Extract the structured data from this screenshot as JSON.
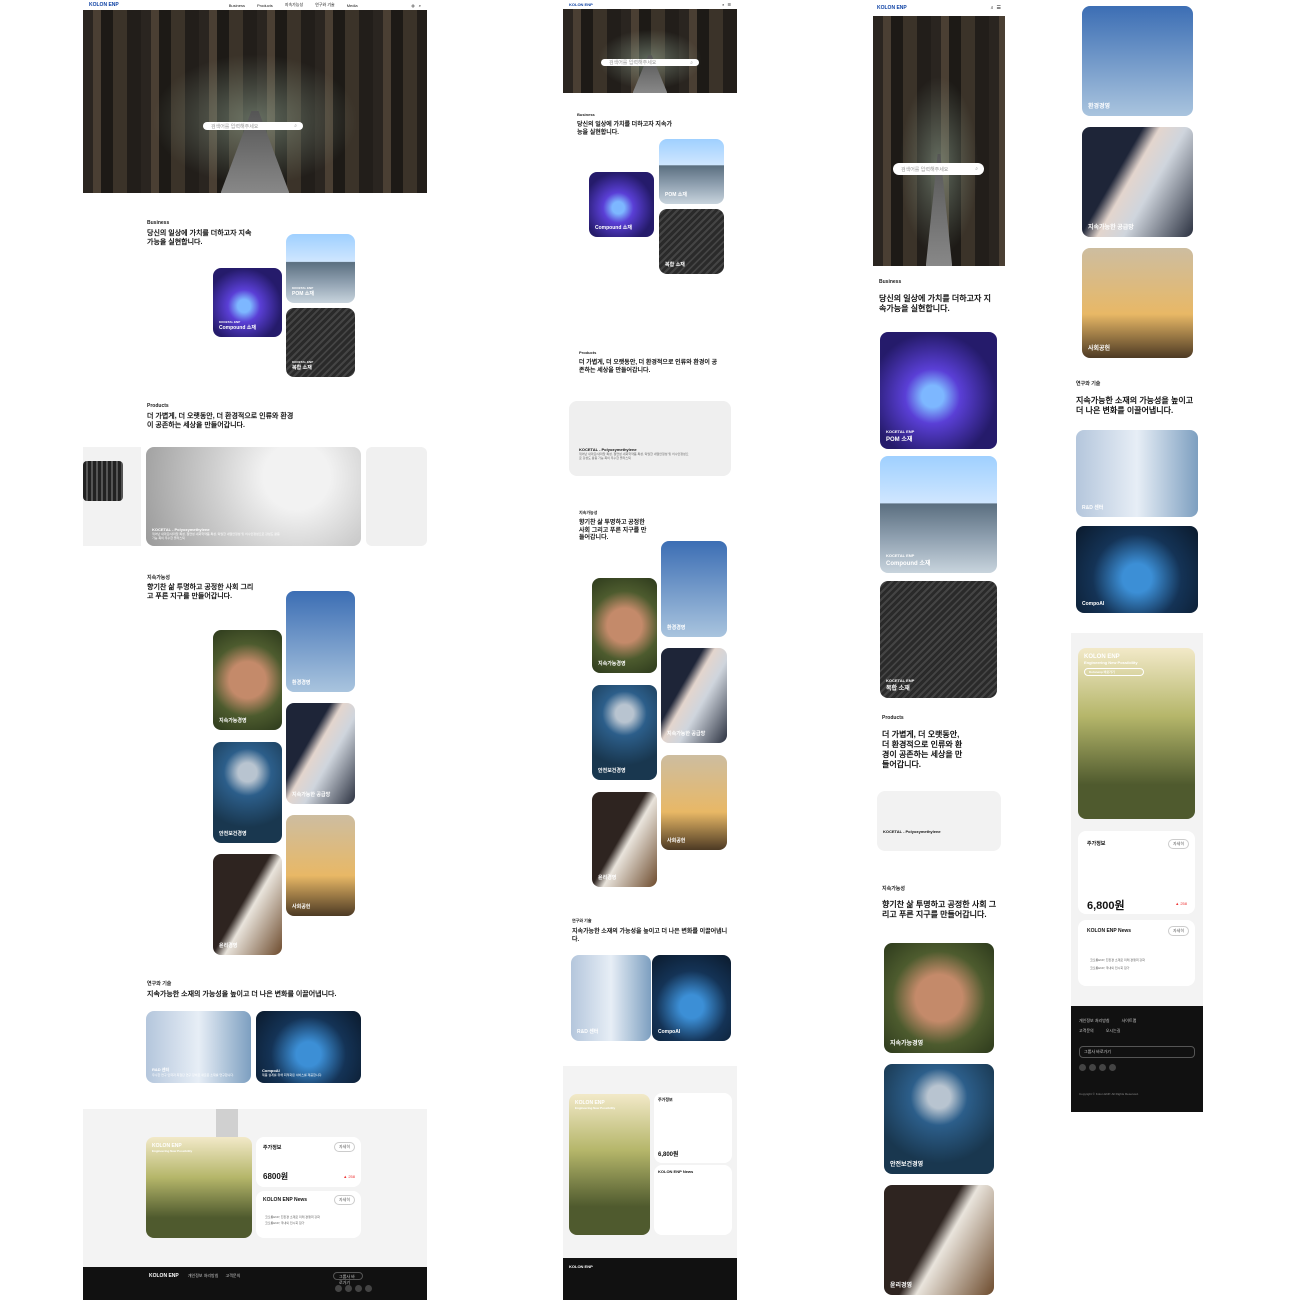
{
  "header": {
    "logo": "KOLON ENP",
    "nav": [
      "Business",
      "Products",
      "지속가능성",
      "연구와 기술",
      "Media"
    ]
  },
  "hero": {
    "search_placeholder": "검색어를 입력해주세요"
  },
  "business": {
    "label": "Business",
    "title": "당신의 일상에 가치를 더하고자 지속가능을 실현합니다.",
    "items": [
      {
        "tag": "KOCETAL ENP",
        "name": "Compound 소재"
      },
      {
        "tag": "KOCETAL ENP",
        "name": "POM 소재"
      },
      {
        "tag": "KOCETAL ENP",
        "name": "복합 소재"
      }
    ]
  },
  "products": {
    "label": "Products",
    "title": "더 가볍게, 더 오랫동안, 더 환경적으로 인류와 환경이 공존하는 세상을 만들어갑니다.",
    "item_title": "KOCETAL - Polyoxymethylene",
    "item_desc": "뛰어난 내마모/내마찰 특성, 절연성·내화학약품 특성, 탁월한 내열안정성 및 치수안정성으로 강성도 활용 가능 폭이 우수한 플라스틱"
  },
  "sustain": {
    "label": "지속가능성",
    "title": "향기찬 삶 투명하고 공정한 사회 그리고 푸른 지구를 만들어갑니다.",
    "items": [
      "환경경영",
      "지속가능경영",
      "지속가능한 공급망",
      "안전보건경영",
      "사회공헌",
      "윤리경영"
    ]
  },
  "rnd": {
    "label": "연구와 기술",
    "title": "지속가능한 소재의 가능성을 높이고 더 나은 변화를 이끌어냅니다.",
    "items": [
      {
        "name": "R&D 센터",
        "desc": "우수한 연구 인력과 최첨단 연구 장비로 새로운 소재를 연구합니다."
      },
      {
        "name": "CompoAI",
        "desc": "제품 설계를 위해 최적화된 서비스를 제공합니다."
      }
    ]
  },
  "promo": {
    "brand": "KOLON ENP",
    "tagline": "Engineering New Possibility",
    "button": "Kolonenp 바로가기"
  },
  "stock": {
    "label": "주가정보",
    "more": "자세히",
    "price": "6,800원",
    "price_short": "6800원",
    "change": "▲ 258"
  },
  "news": {
    "label": "KOLON ENP News",
    "more": "자세히",
    "items": [
      "코오롱ENP, 친환경 소재로 미래 경쟁력 강화",
      "코오롱ENP, 국내외 전시회 참가"
    ]
  },
  "footer": {
    "logo": "KOLON ENP",
    "links": [
      "개인정보 처리방침",
      "고객문의",
      "사이트맵",
      "오시는길"
    ],
    "family": "그룹사 바로가기",
    "copyright": "Copyright © Kolon ENP. All Rights Reserved."
  }
}
